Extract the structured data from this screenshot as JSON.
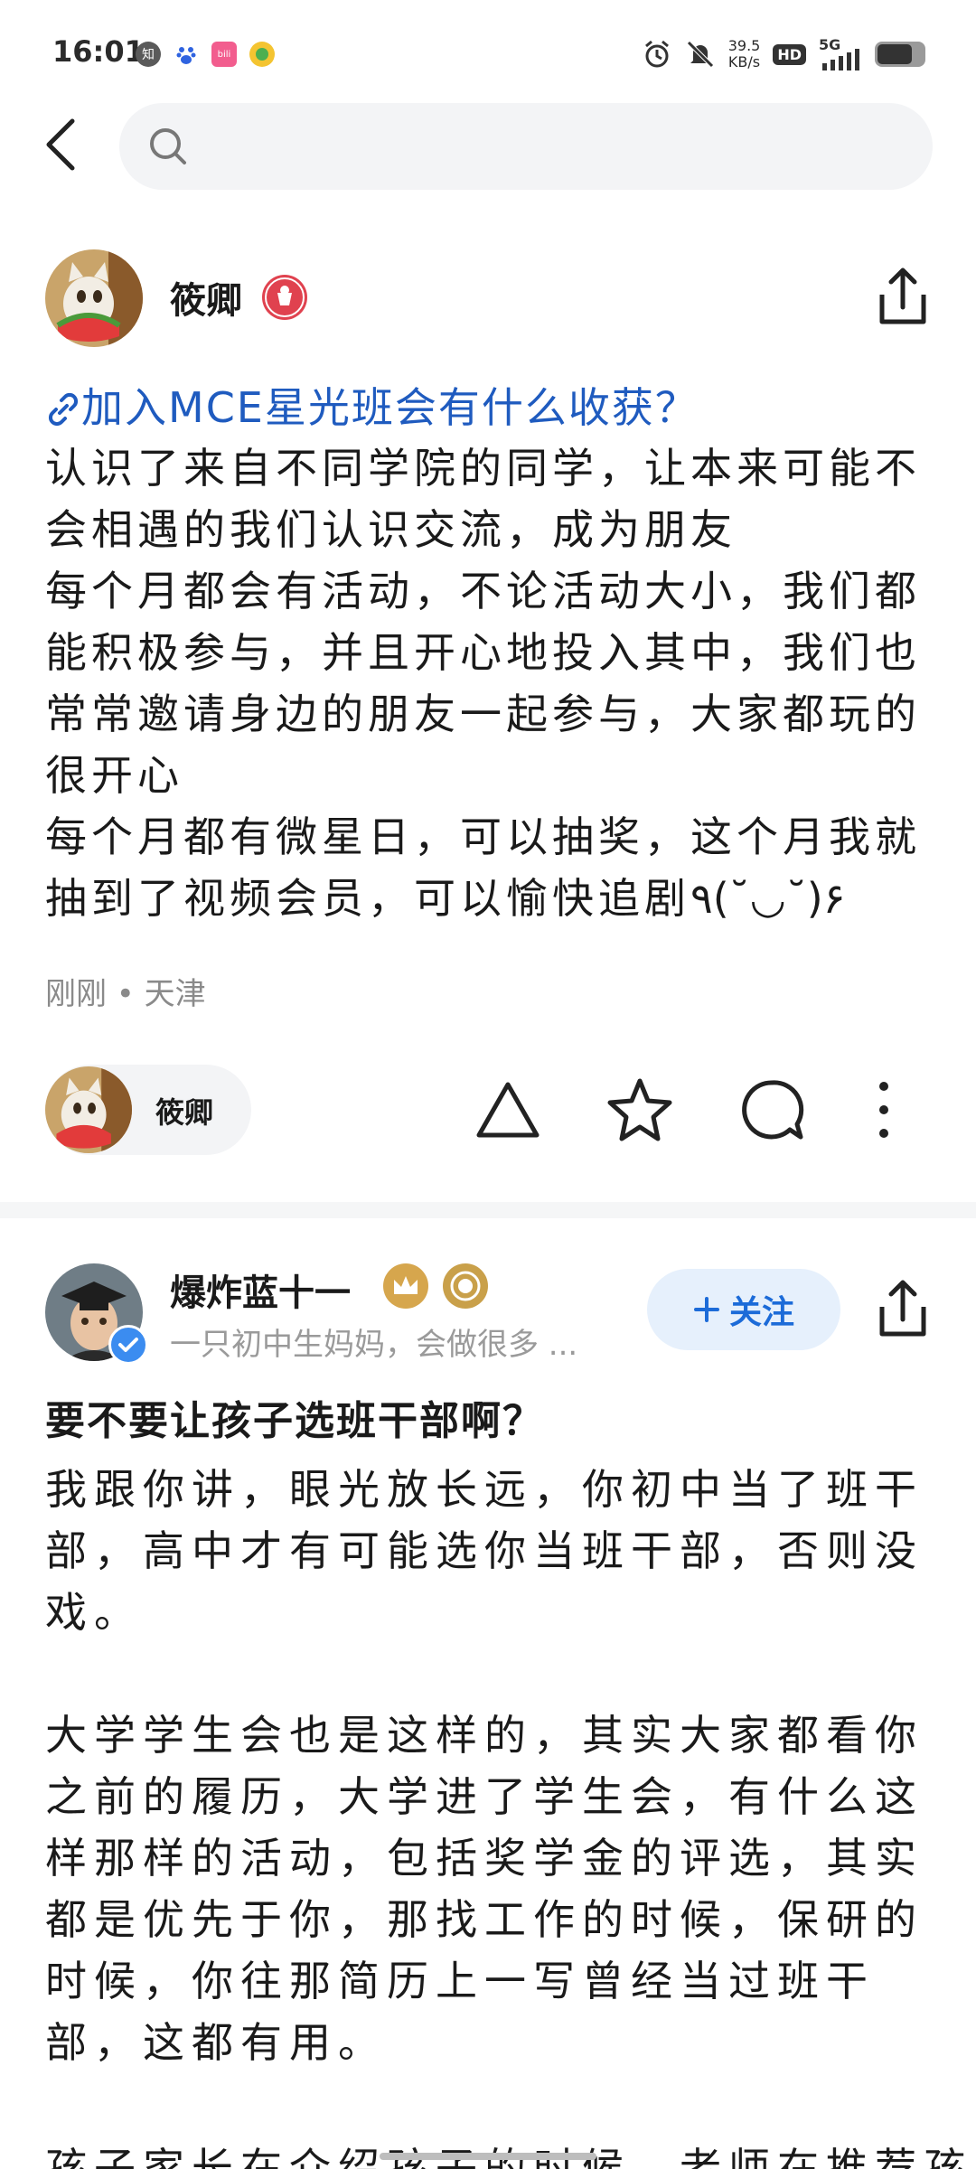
{
  "status_bar": {
    "time": "16:01",
    "app_icons": [
      "zhihu-icon",
      "baidu-icon",
      "bilibili-icon",
      "app-icon"
    ],
    "net_speed_value": "39.5",
    "net_speed_unit": "KB/s",
    "hd_label": "HD",
    "signal_label": "5G",
    "battery_level": 0.75
  },
  "search": {
    "placeholder": ""
  },
  "post1": {
    "author": "筱卿",
    "link_title": "加入MCE星光班会有什么收获？",
    "paragraphs": [
      "认识了来自不同学院的同学，让本来可能不会相遇的我们认识交流，成为朋友",
      "每个月都会有活动，不论活动大小，我们都能积极参与，并且开心地投入其中，我们也常常邀请身边的朋友一起参与，大家都玩的很开心",
      "每个月都有微星日，可以抽奖，这个月我就抽到了视频会员，可以愉快追剧٩(˘◡˘)۶"
    ],
    "meta": "刚刚 • 天津",
    "chip_name": "筱卿"
  },
  "post2": {
    "author": "爆炸蓝十一",
    "author_desc": "一只初中生妈妈，会做很多 ...",
    "follow_label": "关注",
    "title": "要不要让孩子选班干部啊？",
    "paragraphs": [
      "我跟你讲，眼光放长远，你初中当了班干部，高中才有可能选你当班干部，否则没戏。",
      "大学学生会也是这样的，其实大家都看你之前的履历，大学进了学生会，有什么这样那样的活动，包括奖学金的评选，其实都是优先于你，那找工作的时候，保研的时候，你往那简历上一写曾经当过班干部，这都有用。",
      "孩子家长在介绍孩子的时候，老师在推荐孩"
    ]
  },
  "colors": {
    "link": "#1f5bbf",
    "follow_text": "#1c6bd8",
    "follow_bg": "#e6f0fc",
    "verified": "#3b8cf0",
    "red_badge": "#e0424f",
    "gold_badge": "#c9a04a"
  }
}
